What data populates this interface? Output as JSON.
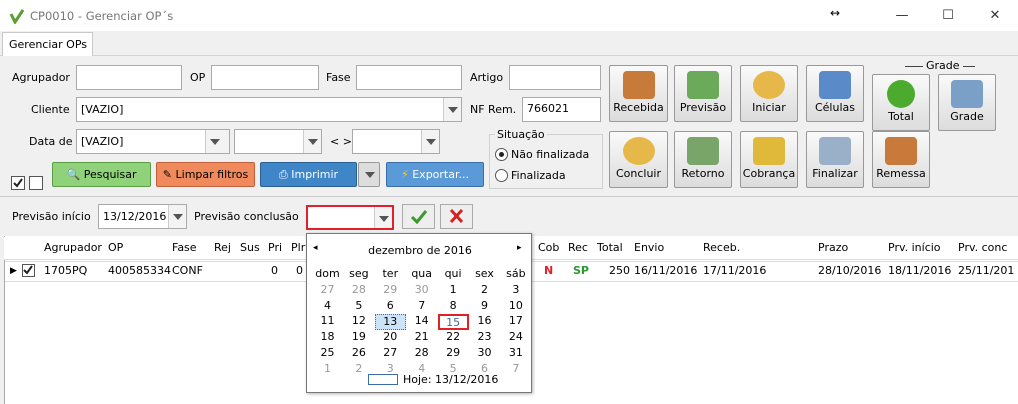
{
  "window": {
    "title": "CP0010 - Gerenciar OP´s",
    "resize_glyph": "↔",
    "minimize": "—",
    "maximize": "☐",
    "close": "✕"
  },
  "tab": {
    "label": "Gerenciar OPs"
  },
  "filters": {
    "agrupador_label": "Agrupador",
    "op_label": "OP",
    "fase_label": "Fase",
    "artigo_label": "Artigo",
    "cliente_label": "Cliente",
    "cliente_value": "[VAZIO]",
    "nfrem_label": "NF Rem.",
    "nfrem_value": "766021",
    "datade_label": "Data de",
    "datade_value": "[VAZIO]",
    "range_sep": "< >",
    "situacao_label": "Situação",
    "nao_finalizada": "Não finalizada",
    "finalizada": "Finalizada",
    "previsao_inicio_label": "Previsão início",
    "previsao_inicio_value": "13/12/2016",
    "previsao_conclusao_label": "Previsão conclusão",
    "previsao_conclusao_value": ""
  },
  "buttons": {
    "pesquisar": "Pesquisar",
    "limpar": "Limpar filtros",
    "imprimir": "Imprimir",
    "exportar": "Exportar...",
    "recebida": "Recebida",
    "previsao": "Previsão",
    "iniciar": "Iniciar",
    "celulas": "Células",
    "concluir": "Concluir",
    "retorno": "Retorno",
    "cobranca": "Cobrança",
    "finalizar": "Finalizar",
    "remessa": "Remessa",
    "grade_group": "Grade",
    "total": "Total",
    "grade": "Grade"
  },
  "table": {
    "headers": [
      "Agrupador",
      "OP",
      "Fase",
      "Rej",
      "Sus",
      "Pri",
      "Plr",
      "Cob",
      "Rec",
      "Total",
      "Envio",
      "Receb.",
      "Prazo",
      "Prv. início",
      "Prv. conc"
    ],
    "row": {
      "agrupador": "1705PQ",
      "op": "400585334",
      "fase": "CONF",
      "pri": "0",
      "plr": "0",
      "cob": "N",
      "rec": "SP",
      "total": "250",
      "envio": "16/11/2016",
      "receb": "17/11/2016",
      "prazo": "28/10/2016",
      "prv_inicio": "18/11/2016",
      "prv_conc": "25/11/201"
    }
  },
  "calendar": {
    "month_label": "dezembro de 2016",
    "prev": "◂",
    "next": "▸",
    "weekdays": [
      "dom",
      "seg",
      "ter",
      "qua",
      "qui",
      "sex",
      "sáb"
    ],
    "weeks": [
      [
        "27",
        "28",
        "29",
        "30",
        "1",
        "2",
        "3"
      ],
      [
        "4",
        "5",
        "6",
        "7",
        "8",
        "9",
        "10"
      ],
      [
        "11",
        "12",
        "13",
        "14",
        "15",
        "16",
        "17"
      ],
      [
        "18",
        "19",
        "20",
        "21",
        "22",
        "23",
        "24"
      ],
      [
        "25",
        "26",
        "27",
        "28",
        "29",
        "30",
        "31"
      ],
      [
        "1",
        "2",
        "3",
        "4",
        "5",
        "6",
        "7"
      ]
    ],
    "today_label": "Hoje: 13/12/2016"
  },
  "colors": {
    "accent_red": "#e0202a",
    "pesquisar_bg": "#8fd27a",
    "limpar_bg": "#f08a5c",
    "imprimir_bg": "#3f86c8",
    "exportar_bg": "#5a9ad8"
  }
}
